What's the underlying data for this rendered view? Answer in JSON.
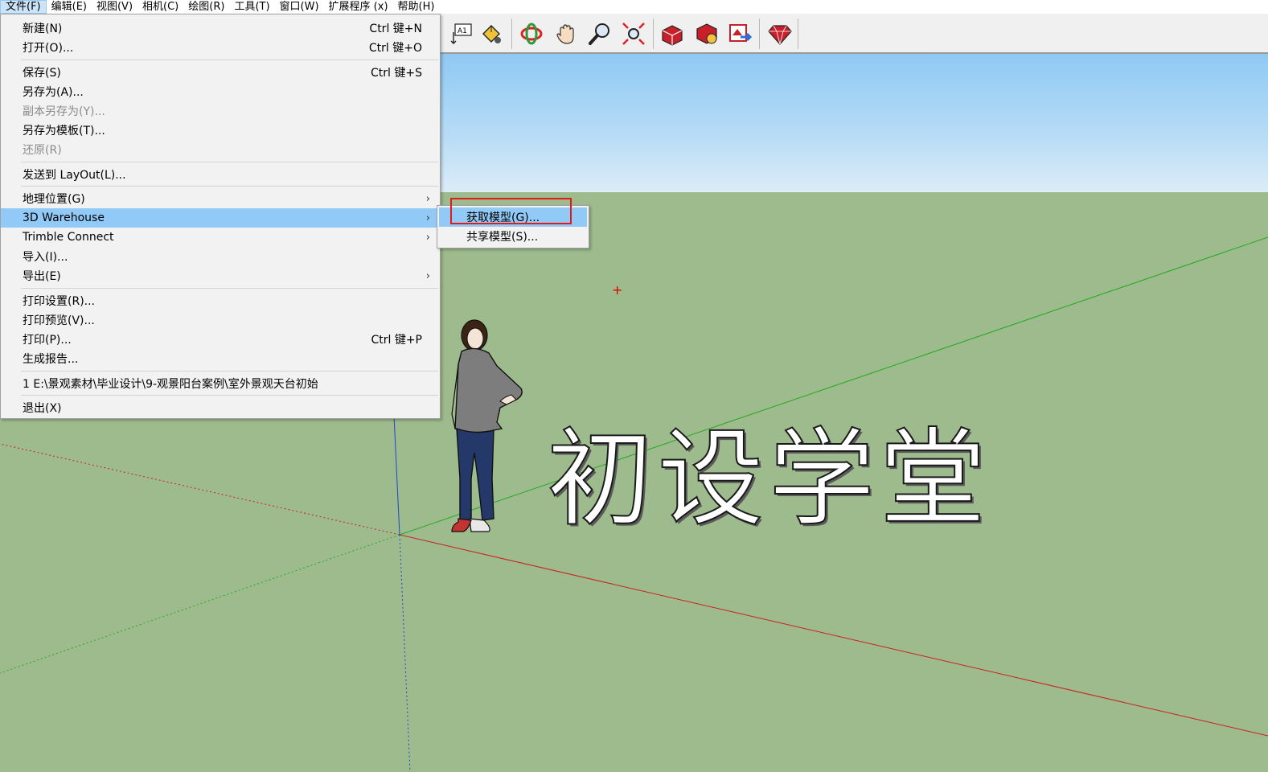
{
  "menubar": {
    "items": [
      {
        "label": "文件(F)"
      },
      {
        "label": "编辑(E)"
      },
      {
        "label": "视图(V)"
      },
      {
        "label": "相机(C)"
      },
      {
        "label": "绘图(R)"
      },
      {
        "label": "工具(T)"
      },
      {
        "label": "窗口(W)"
      },
      {
        "label": "扩展程序 (x)"
      },
      {
        "label": "帮助(H)"
      }
    ]
  },
  "toolbar": {
    "icons": [
      "text-tool-icon",
      "paint-bucket-icon",
      "orbit-icon",
      "pan-icon",
      "zoom-icon",
      "zoom-extents-icon",
      "3d-warehouse-icon",
      "extension-warehouse-icon",
      "send-to-layout-icon",
      "ruby-console-icon"
    ],
    "text_tool_label": "A1"
  },
  "file_menu": {
    "items": [
      {
        "label": "新建(N)",
        "shortcut": "Ctrl 键+N"
      },
      {
        "label": "打开(O)...",
        "shortcut": "Ctrl 键+O"
      },
      {
        "label": "保存(S)",
        "shortcut": "Ctrl 键+S"
      },
      {
        "label": "另存为(A)...",
        "shortcut": ""
      },
      {
        "label": "副本另存为(Y)...",
        "shortcut": "",
        "disabled": true
      },
      {
        "label": "另存为模板(T)...",
        "shortcut": ""
      },
      {
        "label": "还原(R)",
        "shortcut": "",
        "disabled": true
      },
      {
        "label": "发送到 LayOut(L)...",
        "shortcut": ""
      },
      {
        "label": "地理位置(G)",
        "shortcut": "",
        "submenu": true
      },
      {
        "label": "3D Warehouse",
        "shortcut": "",
        "submenu": true,
        "highlighted": true
      },
      {
        "label": "Trimble Connect",
        "shortcut": "",
        "submenu": true
      },
      {
        "label": "导入(I)...",
        "shortcut": ""
      },
      {
        "label": "导出(E)",
        "shortcut": "",
        "submenu": true
      },
      {
        "label": "打印设置(R)...",
        "shortcut": ""
      },
      {
        "label": "打印预览(V)...",
        "shortcut": ""
      },
      {
        "label": "打印(P)...",
        "shortcut": "Ctrl 键+P"
      },
      {
        "label": "生成报告...",
        "shortcut": ""
      },
      {
        "label": "1 E:\\景观素材\\毕业设计\\9-观景阳台案例\\室外景观天台初始",
        "shortcut": ""
      },
      {
        "label": "退出(X)",
        "shortcut": ""
      }
    ],
    "submenu_arrow": "›"
  },
  "warehouse_submenu": {
    "items": [
      {
        "label": "获取模型(G)...",
        "highlighted": true
      },
      {
        "label": "共享模型(S)..."
      }
    ]
  },
  "scene": {
    "text_3d": "初设学堂",
    "marker": "+"
  },
  "colors": {
    "sky_top": "#8ec9f3",
    "ground": "#9dbb8d",
    "menu_highlight": "#91c9f7",
    "callout_red": "#e41a1a",
    "axis_red": "#cc2020",
    "axis_green": "#22aa22",
    "axis_blue": "#2244cc"
  }
}
